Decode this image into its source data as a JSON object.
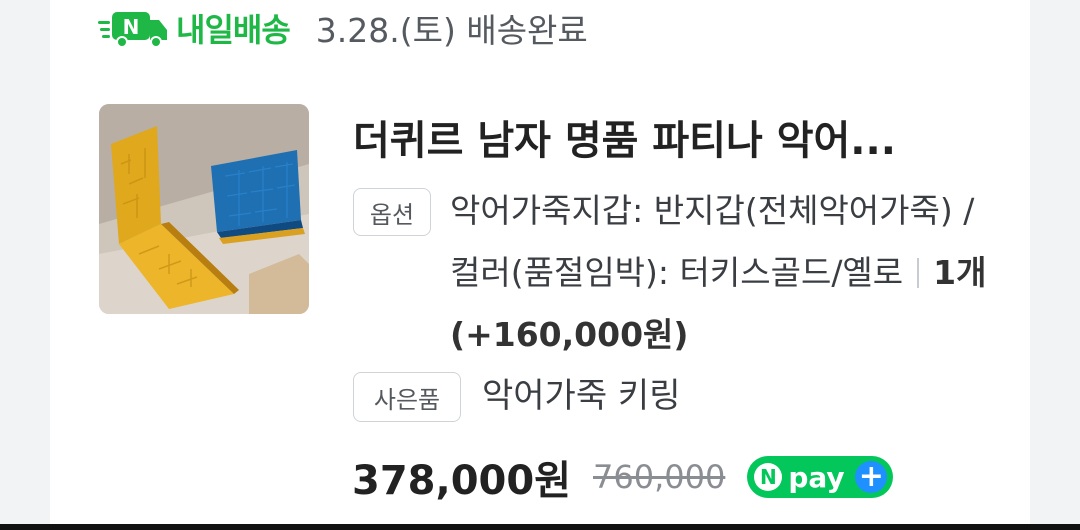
{
  "delivery": {
    "badge_label": "내일배송",
    "badge_icon_letter": "N",
    "status": "3.28.(토) 배송완료",
    "badge_color": "#1fb846",
    "icon": "truck-icon"
  },
  "product": {
    "title": "더퀴르 남자 명품 파티나 악어...",
    "thumbnail_icon": "wallet-image"
  },
  "option": {
    "tag_label": "옵션",
    "text": "악어가죽지갑: 반지갑(전체악어가죽) / 컬러(품절임박): 터키스골드/옐로",
    "quantity": "1개 (+160,000원)"
  },
  "gift": {
    "tag_label": "사은품",
    "text": "악어가죽 키링"
  },
  "price": {
    "sale": "378,000원",
    "original": "760,000",
    "npay_n": "N",
    "npay_label": "pay",
    "npay_plus": "+",
    "npay_color": "#03c75a",
    "npay_plus_color": "#1e90ff"
  }
}
